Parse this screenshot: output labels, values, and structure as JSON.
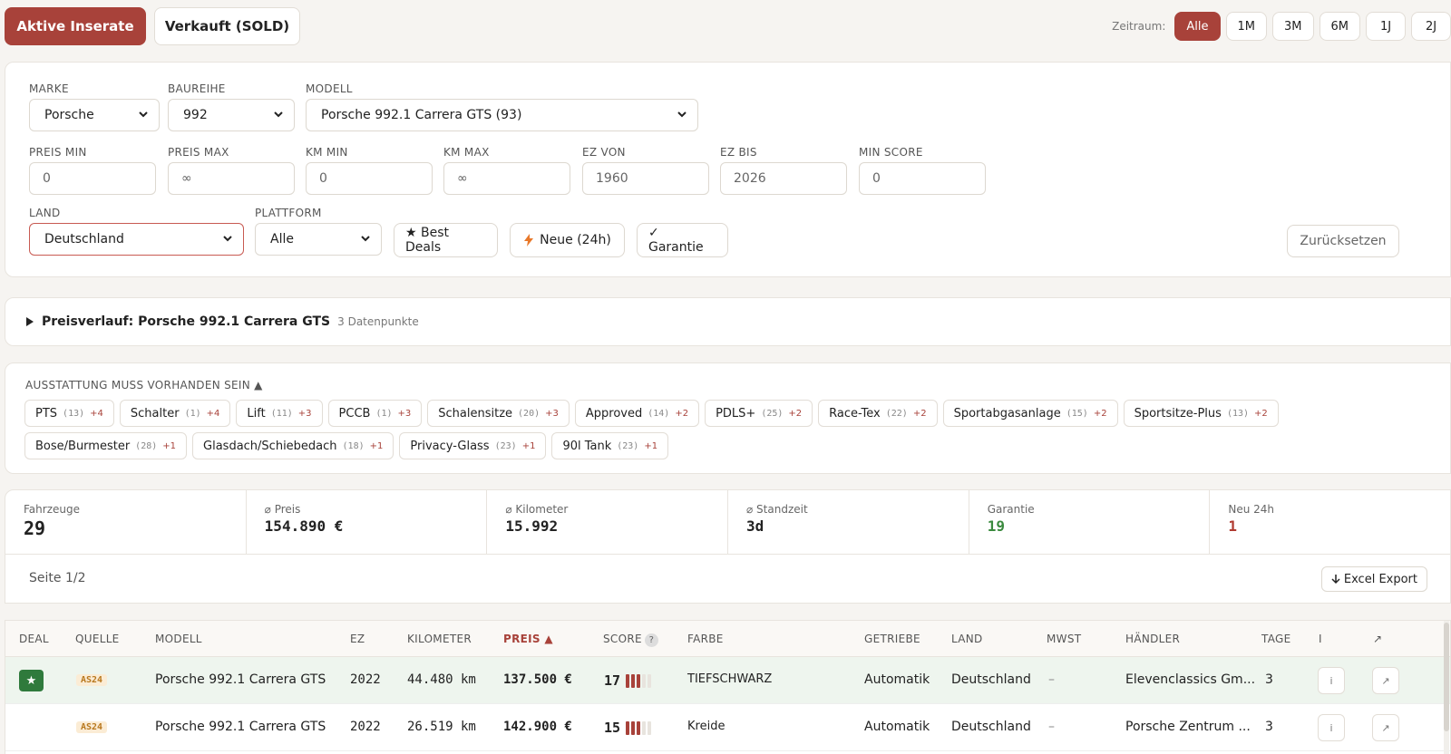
{
  "tabs": {
    "active": "Aktive Inserate",
    "sold": "Verkauft (SOLD)"
  },
  "zeitraum": {
    "label": "Zeitraum:",
    "options": [
      "Alle",
      "1M",
      "3M",
      "6M",
      "1J",
      "2J"
    ],
    "selected": "Alle"
  },
  "filters": {
    "marke": {
      "label": "MARKE",
      "value": "Porsche"
    },
    "baureihe": {
      "label": "BAUREIHE",
      "value": "992"
    },
    "modell": {
      "label": "MODELL",
      "value": "Porsche 992.1 Carrera GTS (93)"
    },
    "preis_min": {
      "label": "PREIS MIN",
      "placeholder": "0"
    },
    "preis_max": {
      "label": "PREIS MAX",
      "placeholder": "∞"
    },
    "km_min": {
      "label": "KM MIN",
      "placeholder": "0"
    },
    "km_max": {
      "label": "KM MAX",
      "placeholder": "∞"
    },
    "ez_von": {
      "label": "EZ VON",
      "placeholder": "1960"
    },
    "ez_bis": {
      "label": "EZ BIS",
      "placeholder": "2026"
    },
    "min_score": {
      "label": "MIN SCORE",
      "placeholder": "0"
    },
    "land": {
      "label": "LAND",
      "value": "Deutschland"
    },
    "plattform": {
      "label": "PLATTFORM",
      "value": "Alle"
    },
    "best_deals": "★ Best Deals",
    "neue": "Neue (24h)",
    "garantie": "✓ Garantie",
    "reset": "Zurücksetzen"
  },
  "preisverlauf": {
    "title": "Preisverlauf: Porsche 992.1 Carrera GTS",
    "sub": "3 Datenpunkte"
  },
  "ausstattung": {
    "heading": "AUSSTATTUNG MUSS VORHANDEN SEIN ▲",
    "tags": [
      {
        "name": "PTS",
        "count": "(13)",
        "plus": "+4"
      },
      {
        "name": "Schalter",
        "count": "(1)",
        "plus": "+4"
      },
      {
        "name": "Lift",
        "count": "(11)",
        "plus": "+3"
      },
      {
        "name": "PCCB",
        "count": "(1)",
        "plus": "+3"
      },
      {
        "name": "Schalensitze",
        "count": "(20)",
        "plus": "+3"
      },
      {
        "name": "Approved",
        "count": "(14)",
        "plus": "+2"
      },
      {
        "name": "PDLS+",
        "count": "(25)",
        "plus": "+2"
      },
      {
        "name": "Race-Tex",
        "count": "(22)",
        "plus": "+2"
      },
      {
        "name": "Sportabgasanlage",
        "count": "(15)",
        "plus": "+2"
      },
      {
        "name": "Sportsitze-Plus",
        "count": "(13)",
        "plus": "+2"
      },
      {
        "name": "Bose/Burmester",
        "count": "(28)",
        "plus": "+1"
      },
      {
        "name": "Glasdach/Schiebedach",
        "count": "(18)",
        "plus": "+1"
      },
      {
        "name": "Privacy-Glass",
        "count": "(23)",
        "plus": "+1"
      },
      {
        "name": "90l Tank",
        "count": "(23)",
        "plus": "+1"
      }
    ]
  },
  "stats": {
    "fahrzeuge": {
      "label": "Fahrzeuge",
      "value": "29"
    },
    "preis": {
      "label": "⌀ Preis",
      "value": "154.890 €"
    },
    "km": {
      "label": "⌀ Kilometer",
      "value": "15.992"
    },
    "standzeit": {
      "label": "⌀ Standzeit",
      "value": "3d"
    },
    "garantie": {
      "label": "Garantie",
      "value": "19"
    },
    "neu": {
      "label": "Neu 24h",
      "value": "1"
    }
  },
  "pager": {
    "seite": "Seite 1/2",
    "export": "Excel Export"
  },
  "table": {
    "headers": {
      "deal": "DEAL",
      "quelle": "QUELLE",
      "modell": "MODELL",
      "ez": "EZ",
      "km": "KILOMETER",
      "preis": "PREIS ▲",
      "score": "SCORE",
      "farbe": "FARBE",
      "getriebe": "GETRIEBE",
      "land": "LAND",
      "mwst": "MWST",
      "haendler": "HÄNDLER",
      "tage": "TAGE",
      "info": "I",
      "link": "↗"
    },
    "rows": [
      {
        "deal": "★",
        "quelle": "AS24",
        "modell": "Porsche 992.1 Carrera GTS",
        "ez": "2022",
        "km": "44.480 km",
        "preis": "137.500 €",
        "score": "17",
        "farbe": "TIEFSCHWARZ",
        "getriebe": "Automatik",
        "land": "Deutschland",
        "mwst": "–",
        "haendler": "Elevenclassics Gm...",
        "tage": "3",
        "info": "i",
        "link": "↗"
      },
      {
        "deal": "",
        "quelle": "AS24",
        "modell": "Porsche 992.1 Carrera GTS",
        "ez": "2022",
        "km": "26.519 km",
        "preis": "142.900 €",
        "score": "15",
        "farbe": "Kreide",
        "getriebe": "Automatik",
        "land": "Deutschland",
        "mwst": "–",
        "haendler": "Porsche Zentrum ...",
        "tage": "3",
        "info": "i",
        "link": "↗"
      }
    ]
  },
  "colors": {
    "accent": "#a8423a",
    "green": "#2f7a3c",
    "quelle_bg": "#fbecd5"
  }
}
